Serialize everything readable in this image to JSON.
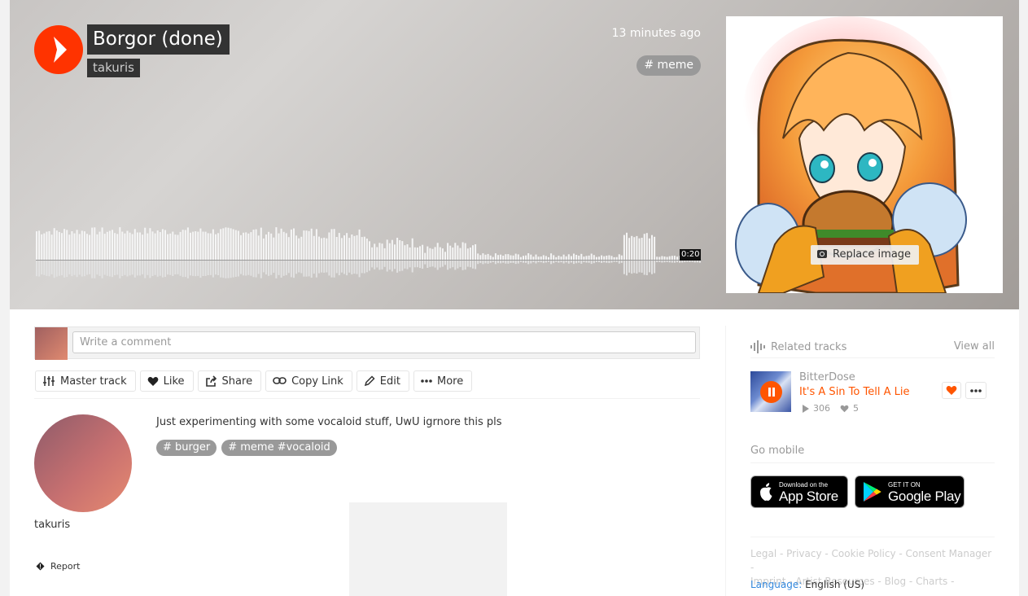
{
  "hero": {
    "title": "Borgor (done)",
    "artist": "takuris",
    "posted": "13 minutes ago",
    "tag": "# meme",
    "duration": "0:20",
    "replace_image": "Replace image"
  },
  "comment": {
    "placeholder": "Write a comment"
  },
  "actions": {
    "master_track": "Master track",
    "like": "Like",
    "share": "Share",
    "copy_link": "Copy Link",
    "edit": "Edit",
    "more": "More"
  },
  "artist_panel": {
    "name": "takuris",
    "report": "Report"
  },
  "description": {
    "text": "Just experimenting with some vocaloid stuff, UwU igrnore this pls",
    "tags": [
      "# burger",
      "# meme #vocaloid"
    ]
  },
  "sidebar": {
    "related_title": "Related tracks",
    "view_all": "View all",
    "related": {
      "artist": "BitterDose",
      "track": "It's A Sin To Tell A Lie",
      "plays": "306",
      "likes": "5"
    },
    "go_mobile": "Go mobile",
    "app_store": {
      "small": "Download on the",
      "big": "App Store"
    },
    "google_play": {
      "small": "GET IT ON",
      "big": "Google Play"
    },
    "footer": {
      "line1": "Legal - Privacy - Cookie Policy - Consent Manager -",
      "line2": "Imprint - Artist Resources - Blog - Charts -"
    },
    "language_label": "Language:",
    "language_value": "English (US)"
  },
  "colors": {
    "accent": "#ff5500",
    "play_orange": "#ff3300",
    "tag_gray": "#999999"
  },
  "icons": [
    "play-icon",
    "camera-icon",
    "sliders-icon",
    "heart-icon",
    "share-icon",
    "link-icon",
    "pencil-icon",
    "ellipsis-icon",
    "flag-icon",
    "waveform-icon",
    "pause-icon",
    "apple-icon",
    "google-play-icon"
  ]
}
